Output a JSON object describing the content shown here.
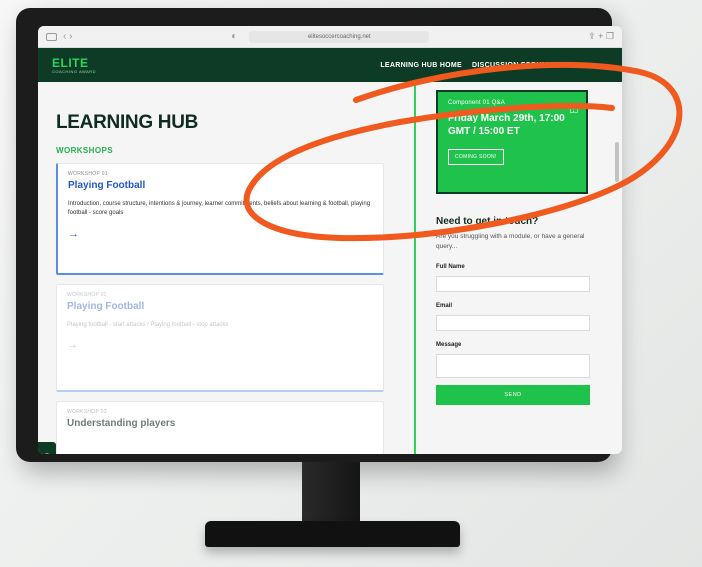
{
  "browser": {
    "url": "elitesoccercoaching.net",
    "nav_back_forward": "‹  ›",
    "right_icons": "⇪  +  ❐"
  },
  "header": {
    "logo_text": "ELITE",
    "logo_sub": "COACHING AWARD",
    "nav": [
      "LEARNING HUB HOME",
      "DISCUSSION FORUM"
    ]
  },
  "main": {
    "title": "LEARNING HUB",
    "section": "WORKSHOPS",
    "cards": [
      {
        "kicker": "WORKSHOP 01",
        "title": "Playing Football",
        "desc": "Introduction, course structure, intentions & journey, learner commitments, beliefs about learning & football, playing football - score goals",
        "arrow": "→"
      },
      {
        "kicker": "WORKSHOP 02",
        "title": "Playing Football",
        "desc": "Playing football - start attacks / Playing football - stop attacks",
        "arrow": "→"
      },
      {
        "kicker": "WORKSHOP 03",
        "title": "Understanding players"
      }
    ]
  },
  "sidebar": {
    "promo": {
      "kicker": "Component 01 Q&A",
      "date": "Friday March 29th, 17:00 GMT / 15:00 ET",
      "button": "COMING SOON!",
      "icon": "chat-question-icon"
    },
    "help_title": "Need to get in touch?",
    "help_sub": "Are you struggling with a module, or have a general query...",
    "fields": {
      "name_label": "Full Name",
      "email_label": "Email",
      "message_label": "Message"
    },
    "send_label": "SEND"
  },
  "colors": {
    "brand_green": "#1fc24a",
    "dark_green": "#0e3b26",
    "link_blue": "#2457c5",
    "annotation_orange": "#f05a1e"
  }
}
